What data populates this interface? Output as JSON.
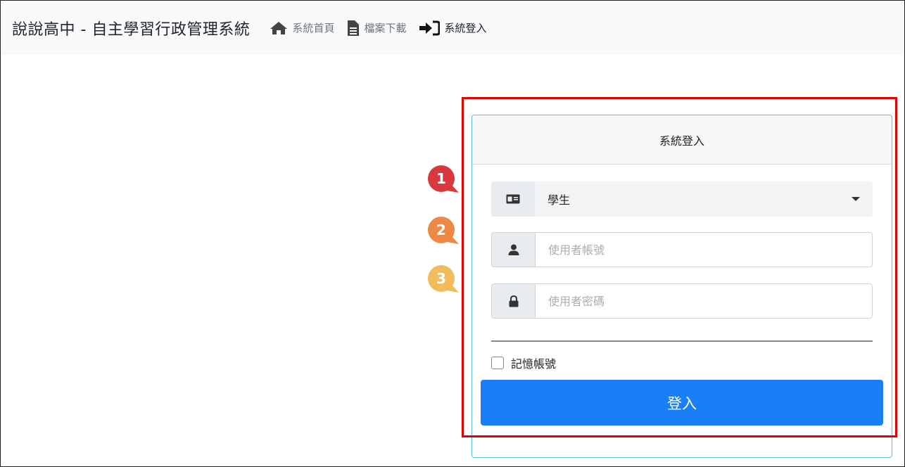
{
  "navbar": {
    "brand": "說說高中 - 自主學習行政管理系統",
    "links": [
      {
        "label": "系統首頁",
        "icon": "home-icon"
      },
      {
        "label": "檔案下載",
        "icon": "file-icon"
      },
      {
        "label": "系統登入",
        "icon": "sign-in-icon"
      }
    ]
  },
  "login": {
    "title": "系統登入",
    "role_select": {
      "value": "學生",
      "icon": "id-card-icon"
    },
    "username": {
      "placeholder": "使用者帳號",
      "icon": "user-icon"
    },
    "password": {
      "placeholder": "使用者密碼",
      "icon": "lock-icon"
    },
    "remember_label": "記憶帳號",
    "submit_label": "登入"
  },
  "badges": [
    {
      "label": "1",
      "color": "#d9383c"
    },
    {
      "label": "2",
      "color": "#ec8a45"
    },
    {
      "label": "3",
      "color": "#f2bb5c"
    }
  ],
  "colors": {
    "highlight": "#e00000",
    "primary_button": "#1a7ff7",
    "card_border": "#5bc0de"
  }
}
